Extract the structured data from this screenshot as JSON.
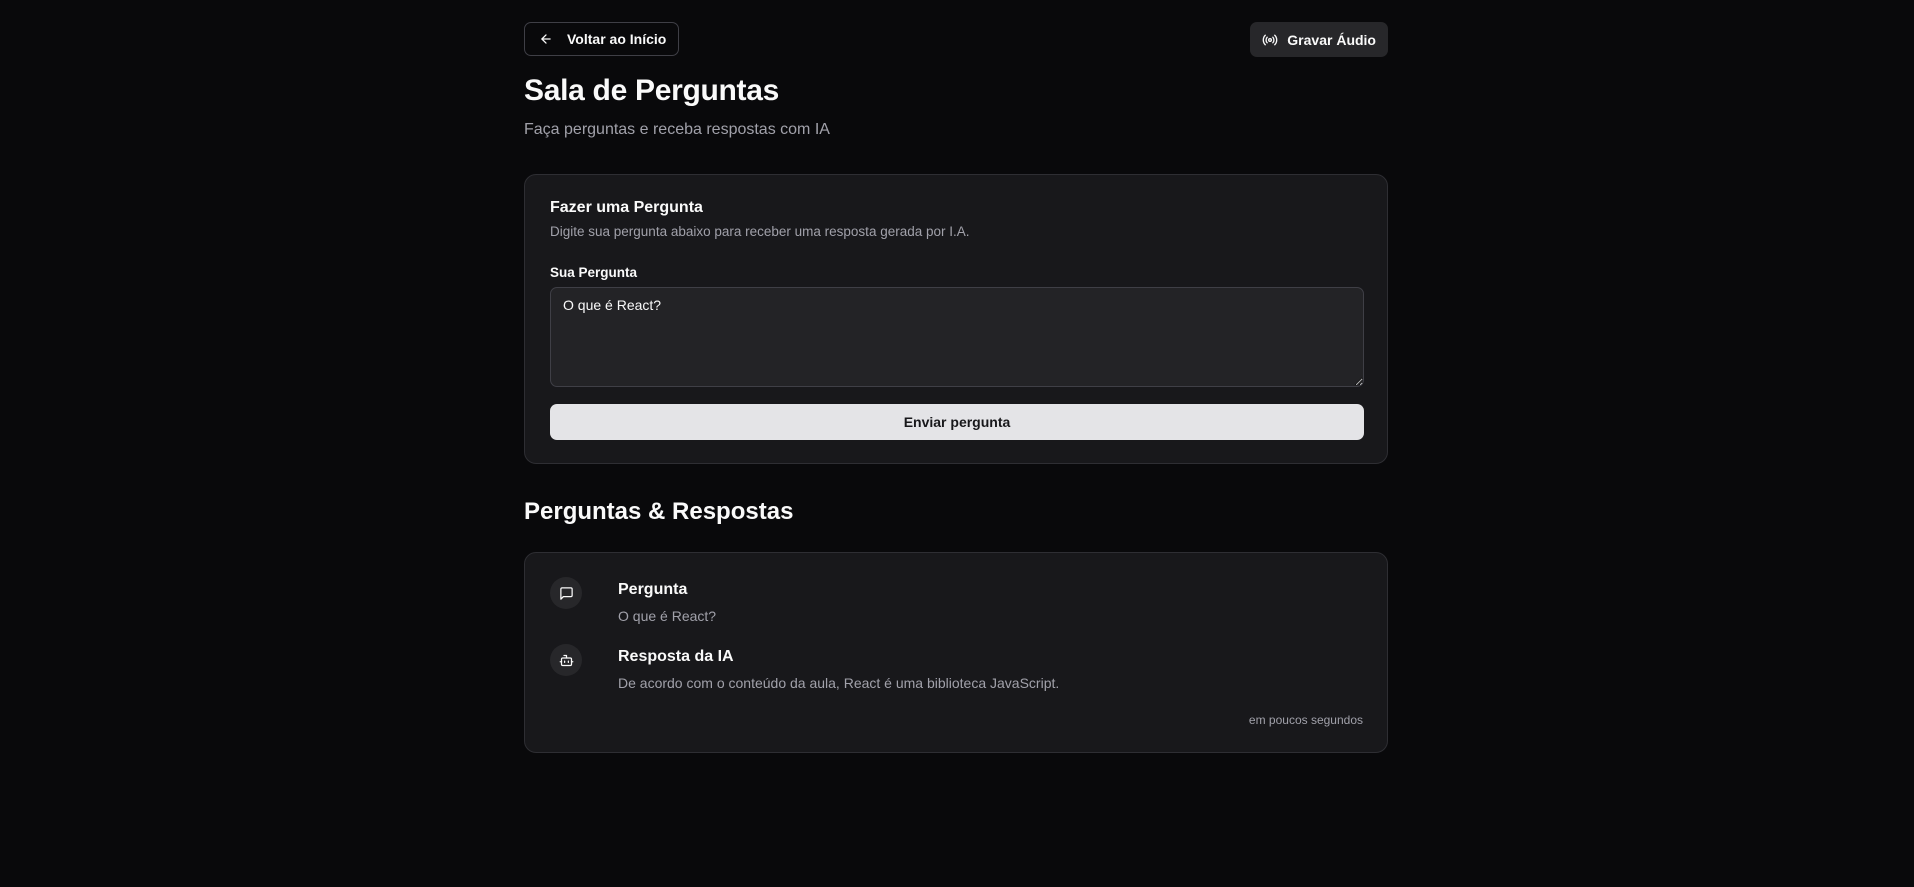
{
  "header": {
    "back_button_label": "Voltar ao Início",
    "record_button_label": "Gravar Áudio"
  },
  "page": {
    "title": "Sala de Perguntas",
    "subtitle": "Faça perguntas e receba respostas com IA"
  },
  "ask_card": {
    "title": "Fazer uma Pergunta",
    "description": "Digite sua pergunta abaixo para receber uma resposta gerada por I.A.",
    "field_label": "Sua Pergunta",
    "field_value": "O que é React?",
    "submit_label": "Enviar pergunta"
  },
  "qa_section": {
    "title": "Perguntas & Respostas",
    "items": [
      {
        "question_heading": "Pergunta",
        "question_text": "O que é React?",
        "answer_heading": "Resposta da IA",
        "answer_text": "De acordo com o conteúdo da aula, React é uma biblioteca JavaScript.",
        "timestamp": "em poucos segundos"
      }
    ]
  },
  "icons": {
    "back": "arrow-left-icon",
    "record": "radio-icon",
    "question": "message-square-icon",
    "answer": "bot-icon"
  },
  "colors": {
    "background": "#09090b",
    "card": "#18181b",
    "muted_text": "#a1a1aa",
    "primary_button": "#e4e4e7"
  }
}
